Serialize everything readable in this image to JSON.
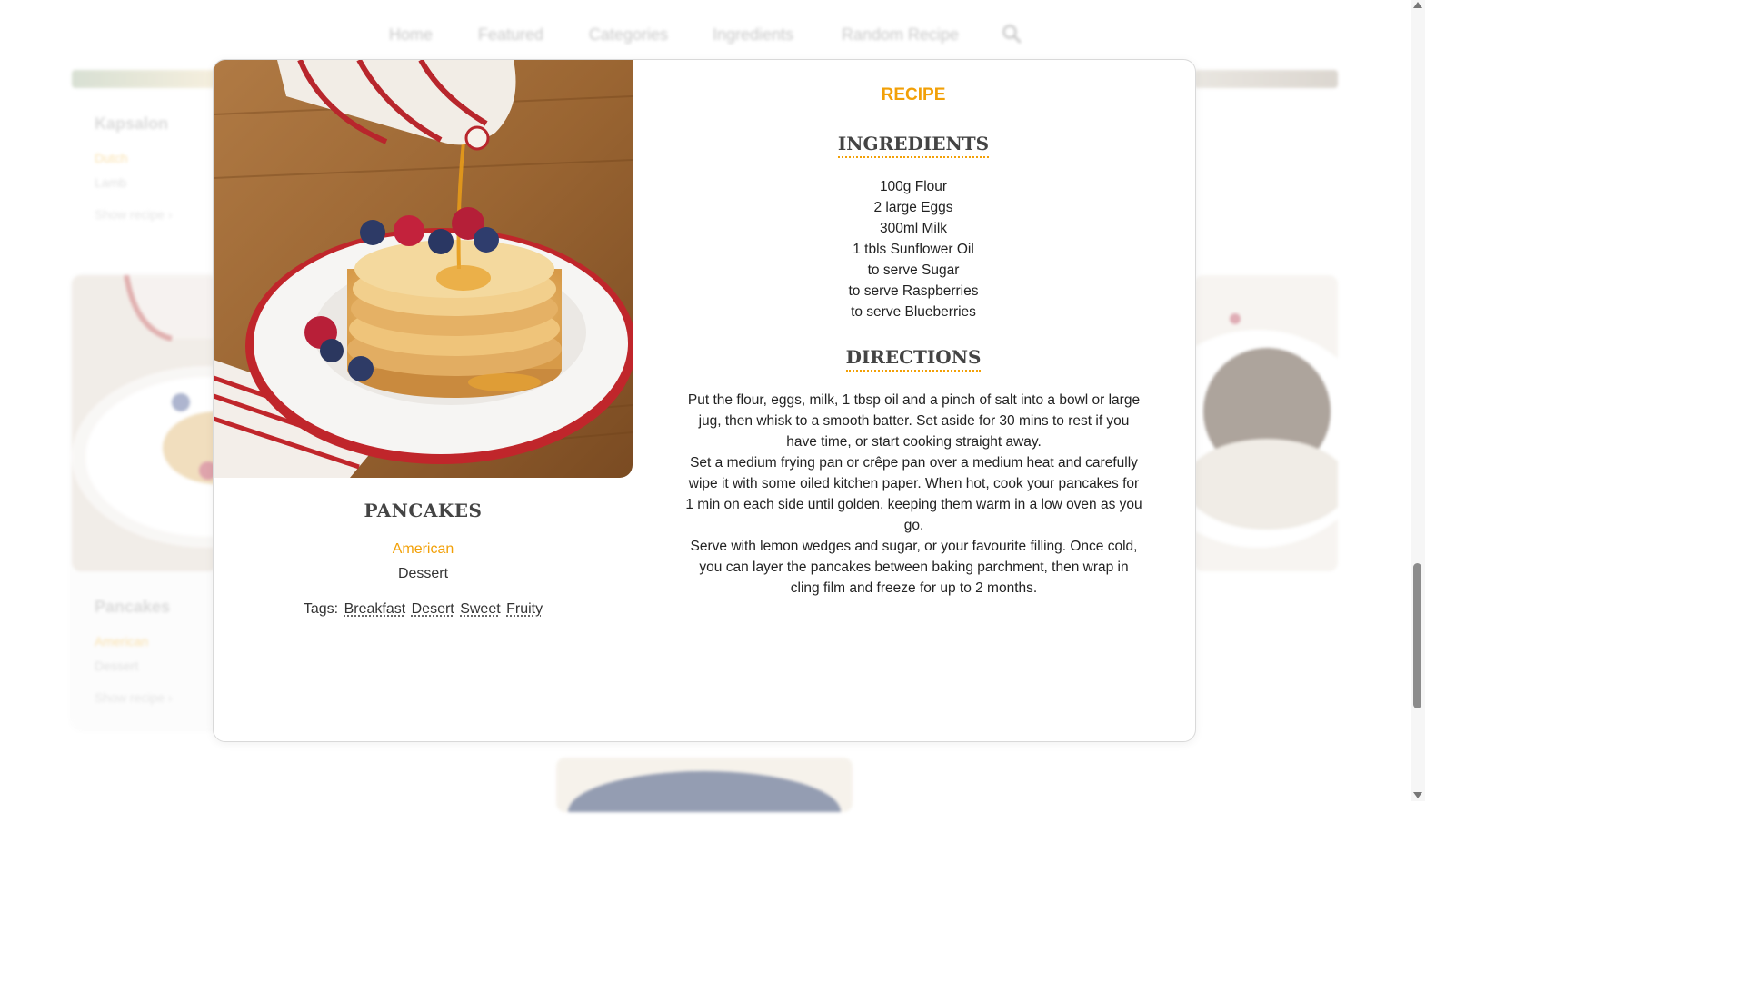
{
  "nav": {
    "items": [
      "Home",
      "Featured",
      "Categories",
      "Ingredients",
      "Random Recipe"
    ],
    "search_icon": "search-icon"
  },
  "background": {
    "card_1": {
      "title": "Kapsalon",
      "cuisine": "Dutch",
      "category": "Lamb",
      "link": "Show recipe ›"
    },
    "card_2": {
      "title": "Pancakes",
      "cuisine": "American",
      "category": "Dessert",
      "link": "Show recipe ›"
    }
  },
  "modal": {
    "kicker": "RECIPE",
    "name": "PANCAKES",
    "cuisine": "American",
    "category": "Dessert",
    "tags_label": "Tags:",
    "tags": [
      "Breakfast",
      "Desert",
      "Sweet",
      "Fruity"
    ],
    "ingredients_heading": "INGREDIENTS",
    "ingredients": [
      "100g Flour",
      "2 large Eggs",
      "300ml Milk",
      "1 tbls Sunflower Oil",
      "to serve Sugar",
      "to serve Raspberries",
      "to serve Blueberries"
    ],
    "directions_heading": "DIRECTIONS",
    "directions": [
      "Put the flour, eggs, milk, 1 tbsp oil and a pinch of salt into a bowl or large jug, then whisk to a smooth batter. Set aside for 30 mins to rest if you have time, or start cooking straight away.",
      "Set a medium frying pan or crêpe pan over a medium heat and carefully wipe it with some oiled kitchen paper. When hot, cook your pancakes for 1 min on each side until golden, keeping them warm in a low oven as you go.",
      "Serve with lemon wedges and sugar, or your favourite filling. Once cold, you can layer the pancakes between baking parchment, then wrap in cling film and freeze for up to 2 months."
    ]
  },
  "colors": {
    "accent": "#f2a007",
    "heading": "#444444",
    "text": "#222222"
  }
}
